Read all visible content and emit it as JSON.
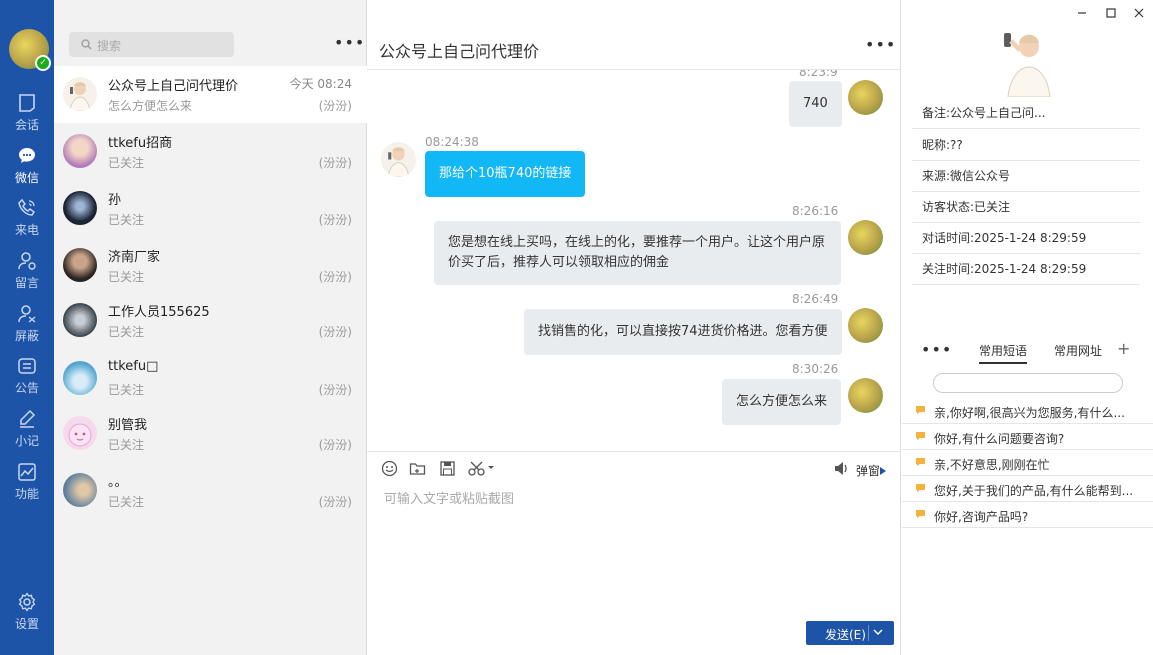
{
  "nav": {
    "items": [
      {
        "label": "会话"
      },
      {
        "label": "微信"
      },
      {
        "label": "来电"
      },
      {
        "label": "留言"
      },
      {
        "label": "屏蔽"
      },
      {
        "label": "公告"
      },
      {
        "label": "小记"
      },
      {
        "label": "功能"
      }
    ],
    "settings": "设置",
    "active_color": "#1d54a8"
  },
  "list": {
    "search_placeholder": "搜索",
    "more": "•••",
    "conversations": [
      {
        "name": "公众号上自己问代理价",
        "preview": "怎么方便怎么来",
        "time": "今天 08:24",
        "agent": "(汾汾)"
      },
      {
        "name": "ttkefu招商",
        "preview": "已关注",
        "time": "",
        "agent": "(汾汾)"
      },
      {
        "name": "孙",
        "preview": "已关注",
        "time": "",
        "agent": "(汾汾)"
      },
      {
        "name": "济南厂家",
        "preview": "已关注",
        "time": "",
        "agent": "(汾汾)"
      },
      {
        "name": "工作人员155625",
        "preview": "已关注",
        "time": "",
        "agent": "(汾汾)"
      },
      {
        "name": "ttkefu□",
        "preview": "已关注",
        "time": "",
        "agent": "(汾汾)"
      },
      {
        "name": "别管我",
        "preview": "已关注",
        "time": "",
        "agent": "(汾汾)"
      },
      {
        "name": "。。",
        "preview": "已关注",
        "time": "",
        "agent": "(汾汾)"
      }
    ]
  },
  "chat": {
    "title": "公众号上自己问代理价",
    "more": "•••",
    "messages": [
      {
        "time": "8:23:9",
        "text": "740",
        "from": "me"
      },
      {
        "time": "08:24:38",
        "text": "那给个10瓶740的链接",
        "from": "them"
      },
      {
        "time": "8:26:16",
        "text": "您是想在线上买吗，在线上的化，要推荐一个用户。让这个用户原价买了后，推荐人可以领取相应的佣金",
        "line1": "您是想在线上买吗，在线上的化，要推荐一个用户。让这个用户原",
        "line2": "价买了后，推荐人可以领取相应的佣金",
        "from": "me"
      },
      {
        "time": "8:26:49",
        "text": "找销售的化，可以直接按74进货价格进。您看方便",
        "from": "me"
      },
      {
        "time": "8:30:26",
        "text": "怎么方便怎么来",
        "from": "me"
      }
    ],
    "popup_label": "弹窗",
    "input_placeholder": "可输入文字或粘贴截图",
    "send_label": "发送(E)"
  },
  "panel": {
    "info": [
      "备注:公众号上自己问...",
      "昵称:??",
      "来源:微信公众号",
      "访客状态:已关注",
      "对话时间:2025-1-24 8:29:59",
      "关注时间:2025-1-24 8:29:59"
    ],
    "more": "•••",
    "tabs": [
      "常用短语",
      "常用网址"
    ],
    "add": "+",
    "phrases": [
      "亲,你好啊,很高兴为您服务,有什么...",
      "你好,有什么问题要咨询?",
      "亲,不好意思,刚刚在忙",
      "您好,关于我们的产品,有什么能帮到...",
      "你好,咨询产品吗?"
    ]
  }
}
